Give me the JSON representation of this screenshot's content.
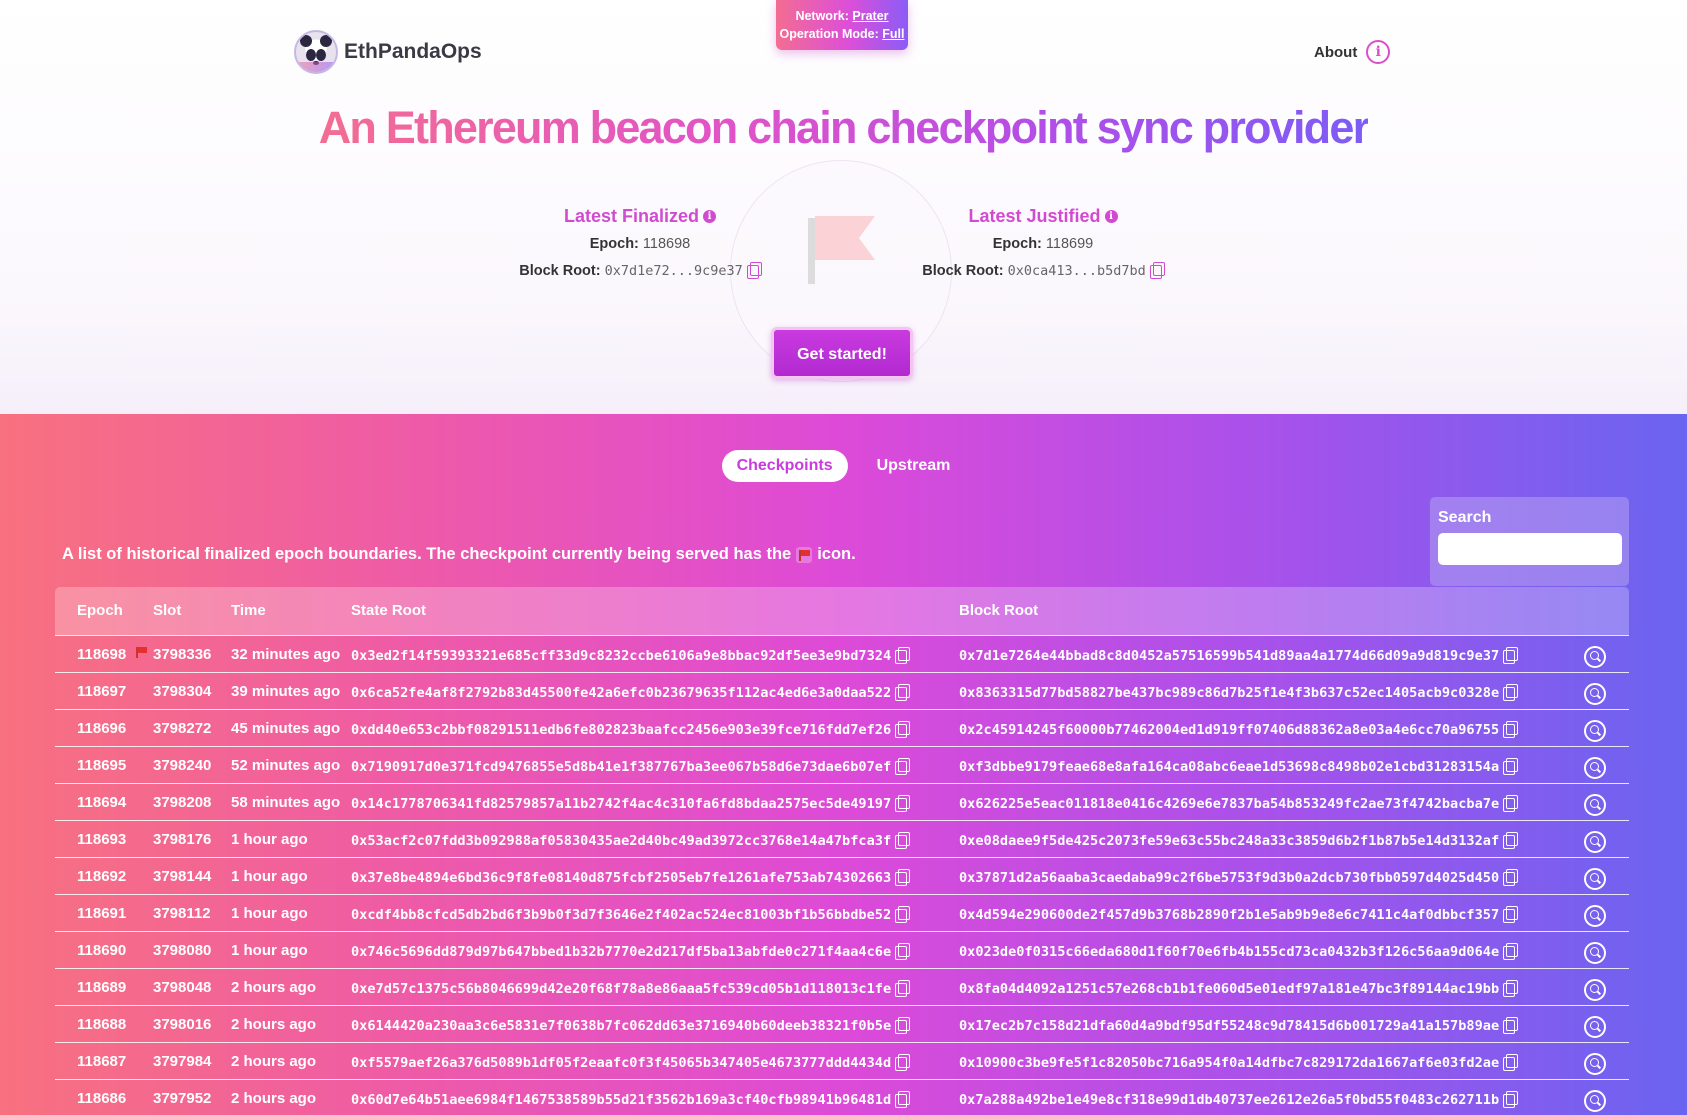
{
  "network": {
    "network_label": "Network:",
    "network_value": "Prater",
    "mode_label": "Operation Mode:",
    "mode_value": "Full"
  },
  "brand": {
    "name": "EthPandaOps"
  },
  "nav": {
    "about_label": "About"
  },
  "hero": {
    "headline": "An Ethereum beacon chain checkpoint sync provider"
  },
  "finalized": {
    "title": "Latest Finalized",
    "epoch_label": "Epoch:",
    "epoch": "118698",
    "root_label": "Block Root:",
    "root": "0x7d1e72...9c9e37"
  },
  "justified": {
    "title": "Latest Justified",
    "epoch_label": "Epoch:",
    "epoch": "118699",
    "root_label": "Block Root:",
    "root": "0x0ca413...b5d7bd"
  },
  "cta": {
    "label": "Get started!"
  },
  "tabs": [
    {
      "label": "Checkpoints",
      "active": true
    },
    {
      "label": "Upstream",
      "active": false
    }
  ],
  "search": {
    "label": "Search",
    "value": "",
    "placeholder": ""
  },
  "description": {
    "before": "A list of historical finalized epoch boundaries. The checkpoint currently being served has the",
    "after": "icon."
  },
  "table": {
    "headers": {
      "epoch": "Epoch",
      "slot": "Slot",
      "time": "Time",
      "state_root": "State Root",
      "block_root": "Block Root"
    },
    "rows": [
      {
        "epoch": "118698",
        "slot": "3798336",
        "time": "32 minutes ago",
        "served": true,
        "state_root": "0x3ed2f14f59393321e685cff33d9c8232ccbe6106a9e8bbac92df5ee3e9bd7324",
        "block_root": "0x7d1e7264e44bbad8c8d0452a57516599b541d89aa4a1774d66d09a9d819c9e37"
      },
      {
        "epoch": "118697",
        "slot": "3798304",
        "time": "39 minutes ago",
        "served": false,
        "state_root": "0x6ca52fe4af8f2792b83d45500fe42a6efc0b23679635f112ac4ed6e3a0daa522",
        "block_root": "0x8363315d77bd58827be437bc989c86d7b25f1e4f3b637c52ec1405acb9c0328e"
      },
      {
        "epoch": "118696",
        "slot": "3798272",
        "time": "45 minutes ago",
        "served": false,
        "state_root": "0xdd40e653c2bbf08291511edb6fe802823baafcc2456e903e39fce716fdd7ef26",
        "block_root": "0x2c45914245f60000b77462004ed1d919ff07406d88362a8e03a4e6cc70a96755"
      },
      {
        "epoch": "118695",
        "slot": "3798240",
        "time": "52 minutes ago",
        "served": false,
        "state_root": "0x7190917d0e371fcd9476855e5d8b41e1f387767ba3ee067b58d6e73dae6b07ef",
        "block_root": "0xf3dbbe9179feae68e8afa164ca08abc6eae1d53698c8498b02e1cbd31283154a"
      },
      {
        "epoch": "118694",
        "slot": "3798208",
        "time": "58 minutes ago",
        "served": false,
        "state_root": "0x14c1778706341fd82579857a11b2742f4ac4c310fa6fd8bdaa2575ec5de49197",
        "block_root": "0x626225e5eac011818e0416c4269e6e7837ba54b853249fc2ae73f4742bacba7e"
      },
      {
        "epoch": "118693",
        "slot": "3798176",
        "time": "1 hour ago",
        "served": false,
        "state_root": "0x53acf2c07fdd3b092988af05830435ae2d40bc49ad3972cc3768e14a47bfca3f",
        "block_root": "0xe08daee9f5de425c2073fe59e63c55bc248a33c3859d6b2f1b87b5e14d3132af"
      },
      {
        "epoch": "118692",
        "slot": "3798144",
        "time": "1 hour ago",
        "served": false,
        "state_root": "0x37e8be4894e6bd36c9f8fe08140d875fcbf2505eb7fe1261afe753ab74302663",
        "block_root": "0x37871d2a56aaba3caedaba99c2f6be5753f9d3b0a2dcb730fbb0597d4025d450"
      },
      {
        "epoch": "118691",
        "slot": "3798112",
        "time": "1 hour ago",
        "served": false,
        "state_root": "0xcdf4bb8cfcd5db2bd6f3b9b0f3d7f3646e2f402ac524ec81003bf1b56bbdbe52",
        "block_root": "0x4d594e290600de2f457d9b3768b2890f2b1e5ab9b9e8e6c7411c4af0dbbcf357"
      },
      {
        "epoch": "118690",
        "slot": "3798080",
        "time": "1 hour ago",
        "served": false,
        "state_root": "0x746c5696dd879d97b647bbed1b32b7770e2d217df5ba13abfde0c271f4aa4c6e",
        "block_root": "0x023de0f0315c66eda680d1f60f70e6fb4b155cd73ca0432b3f126c56aa9d064e"
      },
      {
        "epoch": "118689",
        "slot": "3798048",
        "time": "2 hours ago",
        "served": false,
        "state_root": "0xe7d57c1375c56b8046699d42e20f68f78a8e86aaa5fc539cd05b1d118013c1fe",
        "block_root": "0x8fa04d4092a1251c57e268cb1b1fe060d5e01edf97a181e47bc3f89144ac19bb"
      },
      {
        "epoch": "118688",
        "slot": "3798016",
        "time": "2 hours ago",
        "served": false,
        "state_root": "0x6144420a230aa3c6e5831e7f0638b7fc062dd63e3716940b60deeb38321f0b5e",
        "block_root": "0x17ec2b7c158d21dfa60d4a9bdf95df55248c9d78415d6b001729a41a157b89ae"
      },
      {
        "epoch": "118687",
        "slot": "3797984",
        "time": "2 hours ago",
        "served": false,
        "state_root": "0xf5579aef26a376d5089b1df05f2eaafc0f3f45065b347405e4673777ddd4434d",
        "block_root": "0x10900c3be9fe5f1c82050bc716a954f0a14dfbc7c829172da1667af6e03fd2ae"
      },
      {
        "epoch": "118686",
        "slot": "3797952",
        "time": "2 hours ago",
        "served": false,
        "state_root": "0x60d7e64b51aee6984f1467538589b55d21f3562b169a3cf40cfb98941b96481d",
        "block_root": "0x7a288a492be1e49e8cf318e99d1db40737ee2612e26a5f0bd55f0483c262711b"
      }
    ]
  }
}
